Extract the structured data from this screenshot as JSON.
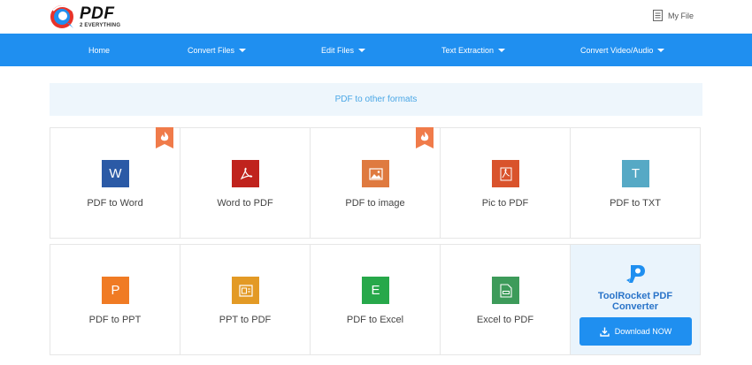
{
  "header": {
    "logo_main": "PDF",
    "logo_sub": "2 EVERYTHING",
    "myfile_label": "My File"
  },
  "nav": {
    "items": [
      {
        "label": "Home",
        "dropdown": false
      },
      {
        "label": "Convert Files",
        "dropdown": true
      },
      {
        "label": "Edit Files",
        "dropdown": true
      },
      {
        "label": "Text Extraction",
        "dropdown": true
      },
      {
        "label": "Convert Video/Audio",
        "dropdown": true
      }
    ]
  },
  "section": {
    "title": "PDF to other formats"
  },
  "tools": [
    {
      "label": "PDF to Word",
      "icon": "word-icon",
      "glyph": "W",
      "color": "#2b5aa6",
      "hot": true
    },
    {
      "label": "Word to PDF",
      "icon": "pdf-acrobat-icon",
      "glyph": "",
      "color": "#c0231d",
      "hot": false
    },
    {
      "label": "PDF to image",
      "icon": "image-icon",
      "glyph": "",
      "color": "#df7a3f",
      "hot": true
    },
    {
      "label": "Pic to PDF",
      "icon": "pdf-acrobat-icon",
      "glyph": "",
      "color": "#d9532c",
      "hot": false
    },
    {
      "label": "PDF to TXT",
      "icon": "text-icon",
      "glyph": "T",
      "color": "#56a9c5",
      "hot": false
    },
    {
      "label": "PDF to PPT",
      "icon": "powerpoint-icon",
      "glyph": "P",
      "color": "#f07b24",
      "hot": false
    },
    {
      "label": "PPT to PDF",
      "icon": "presentation-icon",
      "glyph": "",
      "color": "#e39a25",
      "hot": false
    },
    {
      "label": "PDF to Excel",
      "icon": "excel-icon",
      "glyph": "E",
      "color": "#27a84a",
      "hot": false
    },
    {
      "label": "Excel to PDF",
      "icon": "sheet-pdf-icon",
      "glyph": "",
      "color": "#3d9b5a",
      "hot": false
    }
  ],
  "promo": {
    "title_line1": "ToolRocket PDF",
    "title_line2": "Converter",
    "button_label": "Download NOW",
    "icon": "toolrocket-logo-icon"
  },
  "colors": {
    "nav_bg": "#1f8ff0",
    "banner_bg": "#eef6fc",
    "banner_text": "#4aa7e6",
    "hot_badge": "#f07b4a"
  }
}
